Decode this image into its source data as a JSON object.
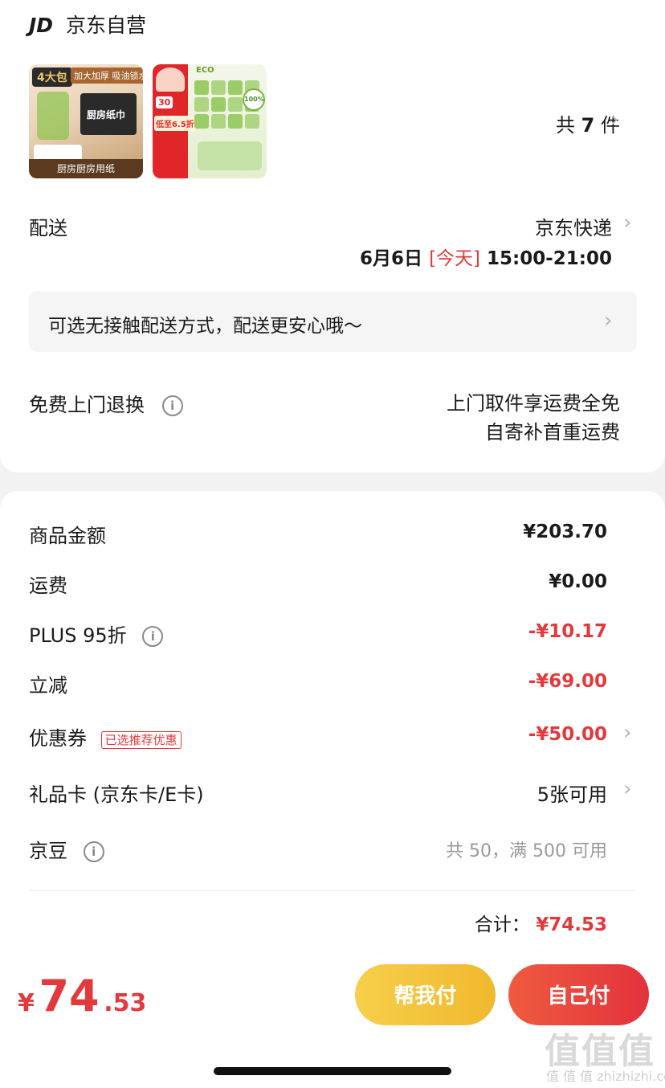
{
  "store": {
    "logo": "JD",
    "name": "京东自营"
  },
  "products": {
    "count_prefix": "共",
    "count": "7",
    "count_suffix": "件",
    "thumb1": {
      "badge": "4大包",
      "banner": "加大加厚 吸油锁水",
      "tag": "厨房纸巾",
      "bottom": "厨房厨房用纸"
    },
    "thumb2": {
      "title": "ECO",
      "badge": "100%",
      "promo": "低至6.5折",
      "note": "30"
    }
  },
  "delivery": {
    "label": "配送",
    "method": "京东快递",
    "date": "6月6日",
    "today": "[今天]",
    "time": "15:00-21:00",
    "contactless": "可选无接触配送方式，配送更安心哦～"
  },
  "returns": {
    "label": "免费上门退换",
    "line1": "上门取件享运费全免",
    "line2": "自寄补首重运费"
  },
  "summary": {
    "goods_label": "商品金额",
    "goods_value": "¥203.70",
    "shipping_label": "运费",
    "shipping_value": "¥0.00",
    "plus_label": "PLUS 95折",
    "plus_value": "-¥10.17",
    "instant_label": "立减",
    "instant_value": "-¥69.00",
    "coupon_label": "优惠券",
    "coupon_tag": "已选推荐优惠",
    "coupon_value": "-¥50.00",
    "giftcard_label": "礼品卡 (京东卡/E卡)",
    "giftcard_value": "5张可用",
    "jingdou_label": "京豆",
    "jingdou_value": "共 50，满 500 可用",
    "total_label": "合计：",
    "total_value": "¥74.53"
  },
  "footer": {
    "currency": "¥",
    "price_int": "74",
    "price_dec": ".53",
    "help_pay": "帮我付",
    "self_pay": "自己付"
  },
  "watermark": "值 值 值 zhizhizhi.com",
  "colors": {
    "accent_red": "#e4393c",
    "help_yellow": "#f3c53b",
    "self_red": "#e8443f"
  }
}
